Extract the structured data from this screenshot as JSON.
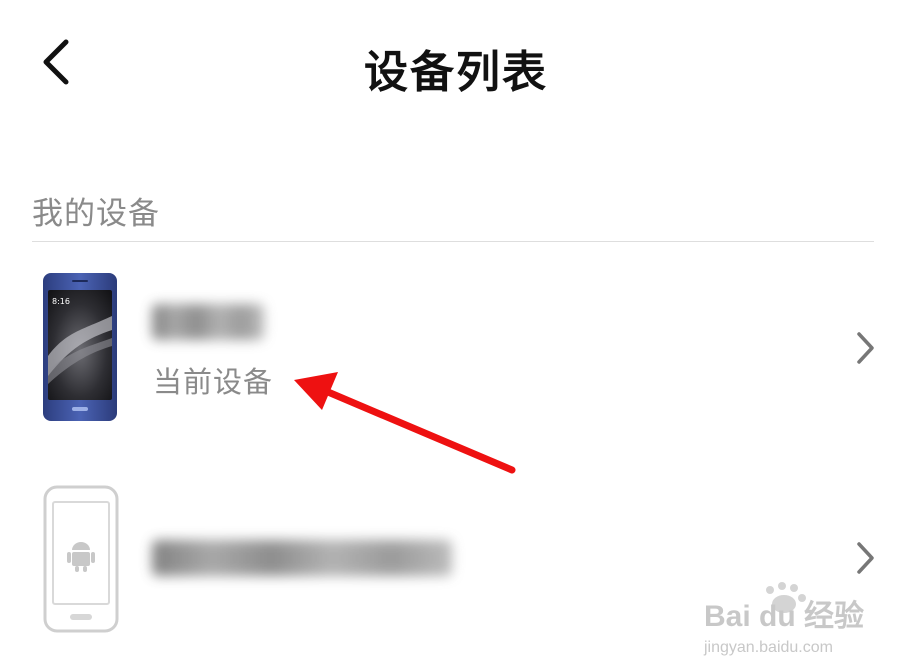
{
  "header": {
    "title": "设备列表",
    "back_icon": "chevron-left-icon"
  },
  "section": {
    "label": "我的设备"
  },
  "devices": [
    {
      "name": "",
      "subtitle": "当前设备",
      "thumbnail_icon": "phone-thumbnail",
      "chevron_icon": "chevron-right-icon"
    },
    {
      "name": "",
      "subtitle": "",
      "thumbnail_icon": "android-phone-icon",
      "chevron_icon": "chevron-right-icon"
    }
  ],
  "watermark": {
    "brand": "Bai du 经验",
    "url": "jingyan.baidu.com"
  },
  "colors": {
    "annotation_arrow": "#ee1111",
    "secondary_text": "#8a8a8a",
    "divider": "#dedede"
  }
}
